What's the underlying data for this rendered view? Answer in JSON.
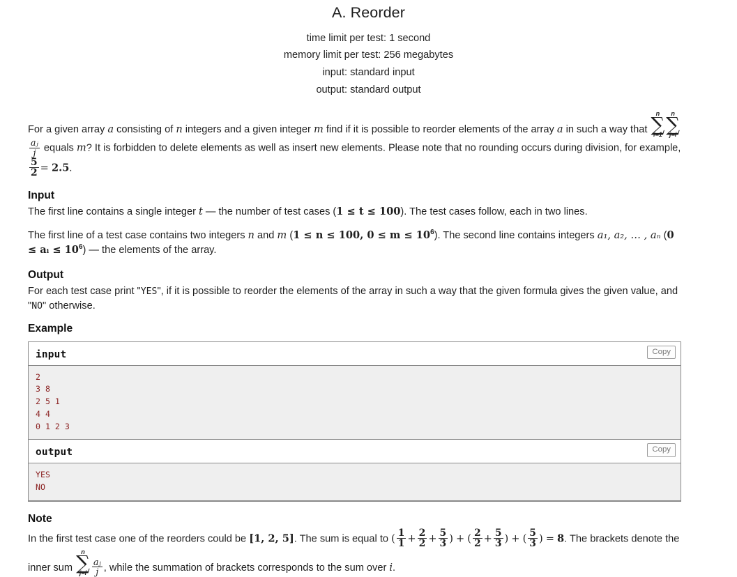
{
  "problem": {
    "title": "A. Reorder",
    "limits": [
      "time limit per test: 1 second",
      "memory limit per test: 256 megabytes",
      "input: standard input",
      "output: standard output"
    ]
  },
  "statement": {
    "text_1": "For a given array ",
    "var_a_1": "a",
    "text_2": " consisting of ",
    "var_n": "n",
    "text_3": " integers and a given integer ",
    "var_m_1": "m",
    "text_4": " find if it is possible to reorder elements of the array ",
    "var_a_2": "a",
    "text_5": " in such a way that ",
    "sum1": {
      "glyph": "∑",
      "top": "n",
      "bottom": "i=1"
    },
    "sum2": {
      "glyph": "∑",
      "top": "n",
      "bottom": "j=i"
    },
    "frac_aj_j": {
      "num": "aⱼ",
      "den": "j"
    },
    "text_6": " equals ",
    "var_m_2": "m",
    "text_7": "? It is forbidden to delete elements as well as insert new elements. Please note that no rounding occurs during division, for example, ",
    "frac_5_2": {
      "num": "5",
      "den": "2"
    },
    "eq": "=",
    "val_25": "2.5",
    "period": "."
  },
  "input_section": {
    "heading": "Input",
    "p1_a": "The first line contains a single integer ",
    "p1_var_t": "t",
    "p1_b": " — the number of test cases (",
    "p1_constraint": "1 ≤ t ≤ 100",
    "p1_c": "). The test cases follow, each in two lines.",
    "p2_a": "The first line of a test case contains two integers ",
    "p2_var_n": "n",
    "p2_b": " and ",
    "p2_var_m": "m",
    "p2_c": " (",
    "p2_constraint_n": "1 ≤ n ≤ 100",
    "p2_comma": ", ",
    "p2_constraint_m": "0 ≤ m ≤ 10",
    "p2_exp_m": "6",
    "p2_d": "). The second line contains integers ",
    "p2_array": "a₁, a₂, … , aₙ",
    "p2_e": " (",
    "p2_constraint_a": "0 ≤ aᵢ ≤ 10",
    "p2_exp_a": "6",
    "p2_f": ") — the elements of the array."
  },
  "output_section": {
    "heading": "Output",
    "text_a": "For each test case print \"",
    "yes": "YES",
    "text_b": "\", if it is possible to reorder the elements of the array in such a way that the given formula gives the given value, and \"",
    "no": "NO",
    "text_c": "\" otherwise."
  },
  "example_section": {
    "heading": "Example",
    "blocks": [
      {
        "title": "input",
        "copy_label": "Copy",
        "data": "2\n3 8\n2 5 1\n4 4\n0 1 2 3"
      },
      {
        "title": "output",
        "copy_label": "Copy",
        "data": "YES\nNO"
      }
    ]
  },
  "note_section": {
    "heading": "Note",
    "text_a": "In the first test case one of the reorders could be ",
    "array": "[1, 2, 5]",
    "text_b": ". The sum is equal to ",
    "formula": {
      "f11": {
        "num": "1",
        "den": "1"
      },
      "f22a": {
        "num": "2",
        "den": "2"
      },
      "f53a": {
        "num": "5",
        "den": "3"
      },
      "f22b": {
        "num": "2",
        "den": "2"
      },
      "f53b": {
        "num": "5",
        "den": "3"
      },
      "f53c": {
        "num": "5",
        "den": "3"
      },
      "result": "8"
    },
    "text_c": ". The brackets denote the inner sum ",
    "sum_j": {
      "glyph": "∑",
      "top": "n",
      "bottom": "j=i"
    },
    "frac_aj_j": {
      "num": "aⱼ",
      "den": "j"
    },
    "text_d": ", while the summation of brackets corresponds to the sum over ",
    "var_i": "i",
    "text_e": "."
  },
  "colors": {
    "example_text": "#8b2222",
    "border": "#888888",
    "example_bg": "#efefef"
  }
}
